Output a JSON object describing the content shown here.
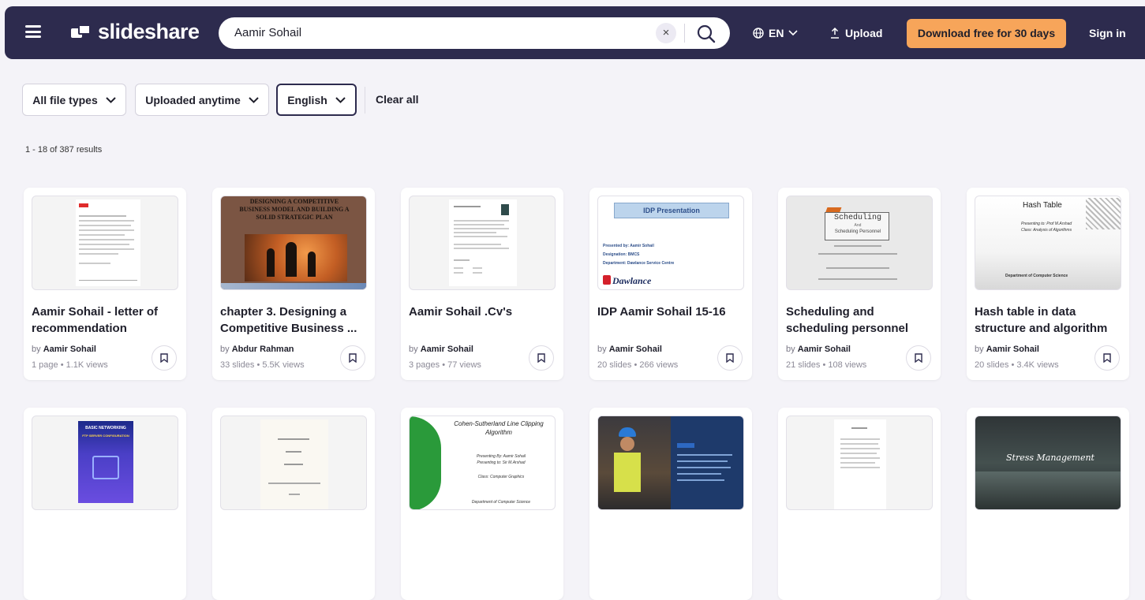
{
  "header": {
    "logo_text": "slideshare",
    "search_value": "Aamir Sohail",
    "lang_label": "EN",
    "upload_label": "Upload",
    "cta_label": "Download free for 30 days",
    "signin_label": "Sign in"
  },
  "filters": {
    "file_types": "All file types",
    "uploaded": "Uploaded anytime",
    "language": "English",
    "clear_all": "Clear all"
  },
  "results_text": "1 - 18 of 387 results",
  "cards": [
    {
      "title": "Aamir Sohail - letter of recommendation",
      "by": "Aamir Sohail",
      "meta": "1 page • 1.1K views"
    },
    {
      "title": "chapter 3. Designing a Competitive Business ...",
      "by": "Abdur Rahman",
      "meta": "33 slides • 5.5K views",
      "thumb_text": "DESIGNING A COMPETITIVE BUSINESS MODEL AND BUILDING A SOLID STRATEGIC PLAN"
    },
    {
      "title": "Aamir Sohail .Cv's",
      "by": "Aamir Sohail",
      "meta": "3 pages • 77 views"
    },
    {
      "title": "IDP Aamir Sohail 15-16",
      "by": "Aamir Sohail",
      "meta": "20 slides • 266 views",
      "thumb_title": "IDP Presentation",
      "thumb_lines": [
        "Presented by: Aamir Sohail",
        "Designation: BMCS",
        "Department: Dawlance Service Centre"
      ],
      "thumb_brand": "Dawlance"
    },
    {
      "title": "Scheduling and scheduling personnel",
      "by": "Aamir Sohail",
      "meta": "21 slides • 108 views",
      "thumb_title": "Scheduling",
      "thumb_sub": "And",
      "thumb_sub2": "Scheduling Personnel"
    },
    {
      "title": "Hash table in data structure and algorithm",
      "by": "Aamir Sohail",
      "meta": "20 slides • 3.4K views",
      "thumb_title": "Hash Table",
      "thumb_l1": "Presenting to: Prof M.Arshad",
      "thumb_l2": "Class: Analysis of Algorithms",
      "thumb_footer": "Department of Computer Science"
    }
  ],
  "row2": [
    {
      "thumb_title": "BASIC NETWORKING",
      "thumb_sub": "FTP SERVER CONFIGURATION"
    },
    {},
    {
      "thumb_title": "Cohen-Sutherland Line Clipping Algorithm",
      "thumb_l1": "Presenting By: Aamir Sohail",
      "thumb_l2": "Presenting to: Sir M.Arshad",
      "thumb_l3": "Class: Computer Graphics",
      "thumb_footer": "Department of Computer Science"
    },
    {},
    {},
    {
      "thumb_title": "Stress Management"
    }
  ],
  "colors": {
    "header_bg": "#2d2b4e",
    "cta_bg": "#f7a55a",
    "page_bg": "#f4f3f8"
  },
  "icons": {
    "menu": "hamburger-icon",
    "search": "search-icon",
    "clear": "close-icon",
    "globe": "globe-icon",
    "upload": "upload-icon",
    "bookmark": "bookmark-icon",
    "chevron": "chevron-down-icon"
  }
}
